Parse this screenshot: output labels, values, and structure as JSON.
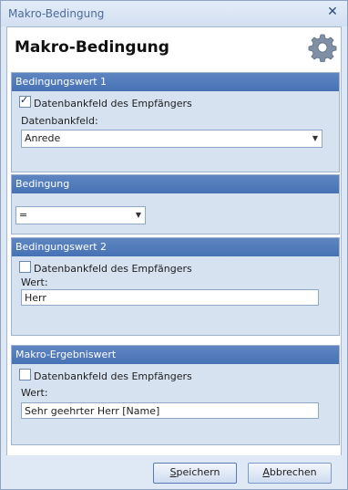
{
  "window": {
    "title": "Makro-Bedingung",
    "close_glyph": "✕"
  },
  "header": {
    "heading": "Makro-Bedingung",
    "icon": "gear-icon"
  },
  "section1": {
    "title": "Bedingungswert 1",
    "checkbox_label": "Datenbankfeld des Empfängers",
    "checkbox_checked": true,
    "field_label": "Datenbankfeld:",
    "field_value": "Anrede"
  },
  "section2": {
    "title": "Bedingung",
    "operator_value": "="
  },
  "section3": {
    "title": "Bedingungswert 2",
    "checkbox_label": "Datenbankfeld des Empfängers",
    "checkbox_checked": false,
    "value_label": "Wert:",
    "value": "Herr"
  },
  "section4": {
    "title": "Makro-Ergebniswert",
    "checkbox_label": "Datenbankfeld des Empfängers",
    "checkbox_checked": false,
    "value_label": "Wert:",
    "value": "Sehr geehrter Herr [Name]"
  },
  "footer": {
    "save_hotkey": "S",
    "save_rest": "peichern",
    "cancel_hotkey": "A",
    "cancel_rest": "bbrechen"
  }
}
